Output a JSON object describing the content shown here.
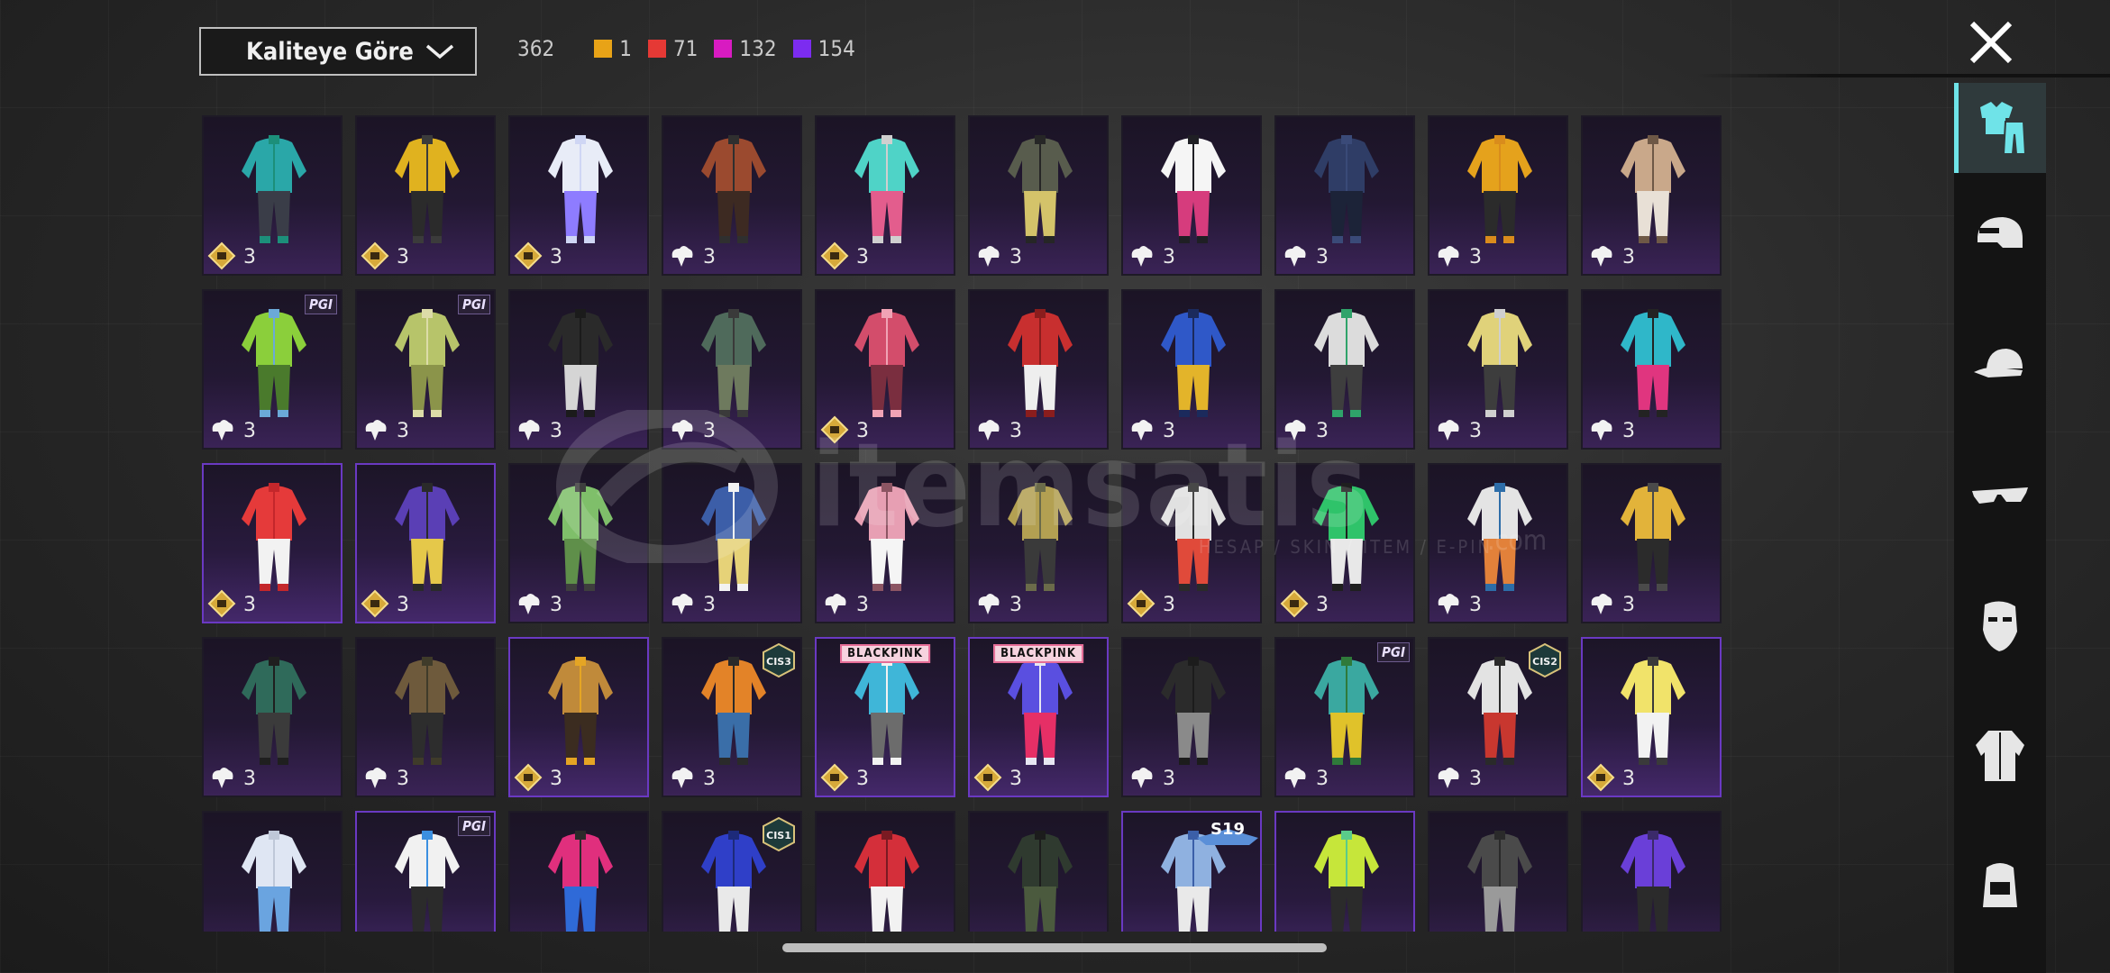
{
  "sort": {
    "label": "Kaliteye Göre"
  },
  "counts": {
    "total": "362",
    "tiers": [
      {
        "color": "#e8a317",
        "value": "1"
      },
      {
        "color": "#e53935",
        "value": "71"
      },
      {
        "color": "#d81bc1",
        "value": "132"
      },
      {
        "color": "#7c2cf0",
        "value": "154"
      }
    ]
  },
  "watermark": {
    "text": "itemsatis",
    "domain": ".com",
    "sub": "HESAP / SKIN / ITEM / E-PIN"
  },
  "grid": {
    "quantity_label": "3",
    "rows": [
      [
        {
          "q": "mythic",
          "hl": false,
          "palette": [
            "#2aa7a8",
            "#3a3d48",
            "#1c8f7a"
          ]
        },
        {
          "q": "mythic",
          "hl": false,
          "palette": [
            "#e0b21f",
            "#2b2b2b",
            "#3b3b3b"
          ]
        },
        {
          "q": "mythic",
          "hl": false,
          "palette": [
            "#e8ecf7",
            "#8e7cff",
            "#cfd6f4"
          ]
        },
        {
          "q": "legendary",
          "hl": false,
          "palette": [
            "#9b4a2f",
            "#3d2a22",
            "#2f2f2f"
          ]
        },
        {
          "q": "mythic",
          "hl": false,
          "palette": [
            "#4fd3c7",
            "#e35d8d",
            "#cfcfcf"
          ]
        },
        {
          "q": "legendary",
          "hl": false,
          "palette": [
            "#585c4d",
            "#d4c36a",
            "#262626"
          ]
        },
        {
          "q": "legendary",
          "hl": false,
          "palette": [
            "#f5f5f5",
            "#d63c7d",
            "#1f1f24"
          ]
        },
        {
          "q": "legendary",
          "hl": false,
          "palette": [
            "#2f3d66",
            "#1c2338",
            "#3a4a78"
          ]
        },
        {
          "q": "legendary",
          "hl": false,
          "palette": [
            "#e5a21c",
            "#2b2b2b",
            "#d98c1c"
          ]
        },
        {
          "q": "legendary",
          "hl": false,
          "palette": [
            "#c9a88a",
            "#e8e0d6",
            "#6e5846"
          ]
        }
      ],
      [
        {
          "q": "legendary",
          "hl": false,
          "palette": [
            "#8bcf3b",
            "#4a7a2c",
            "#6ba9d8"
          ],
          "badge": "pgi"
        },
        {
          "q": "legendary",
          "hl": false,
          "palette": [
            "#b7c46a",
            "#8b944a",
            "#dcdca8"
          ],
          "badge": "pgi"
        },
        {
          "q": "legendary",
          "hl": false,
          "palette": [
            "#2a2a2a",
            "#d5d5d5",
            "#1b1b1b"
          ]
        },
        {
          "q": "legendary",
          "hl": false,
          "palette": [
            "#4f6a5b",
            "#6e7a5e",
            "#3a3a3a"
          ]
        },
        {
          "q": "mythic",
          "hl": false,
          "palette": [
            "#d34d6b",
            "#7a2e3f",
            "#f0a3b5"
          ]
        },
        {
          "q": "legendary",
          "hl": false,
          "palette": [
            "#c82f2f",
            "#eeeeee",
            "#8a1d1d"
          ]
        },
        {
          "q": "legendary",
          "hl": false,
          "palette": [
            "#2f58c8",
            "#e3b42a",
            "#1b2a5c"
          ]
        },
        {
          "q": "legendary",
          "hl": false,
          "palette": [
            "#dcdcdc",
            "#3e3e3e",
            "#2fa36a"
          ]
        },
        {
          "q": "legendary",
          "hl": false,
          "palette": [
            "#e0d27a",
            "#3d3d3d",
            "#cfcfcf"
          ]
        },
        {
          "q": "legendary",
          "hl": false,
          "palette": [
            "#2fb7c9",
            "#e0357f",
            "#232323"
          ]
        }
      ],
      [
        {
          "q": "mythic",
          "hl": true,
          "palette": [
            "#e53a3a",
            "#f2f2f2",
            "#c4272b"
          ]
        },
        {
          "q": "mythic",
          "hl": true,
          "palette": [
            "#5a3fb5",
            "#e5c84a",
            "#2a2a2a"
          ]
        },
        {
          "q": "legendary",
          "hl": false,
          "palette": [
            "#7fbf6a",
            "#5f8f4a",
            "#3e3e3e"
          ]
        },
        {
          "q": "legendary",
          "hl": false,
          "palette": [
            "#3c5ea8",
            "#e6d278",
            "#f2f2f2"
          ]
        },
        {
          "q": "legendary",
          "hl": false,
          "palette": [
            "#e79fb3",
            "#f5f5f5",
            "#8c5563"
          ]
        },
        {
          "q": "legendary",
          "hl": false,
          "palette": [
            "#b3a052",
            "#3a3a3a",
            "#6b6b4a"
          ]
        },
        {
          "q": "mythic",
          "hl": false,
          "palette": [
            "#e1e1e1",
            "#e04a3a",
            "#2a2a2a"
          ]
        },
        {
          "q": "mythic",
          "hl": false,
          "palette": [
            "#2fc36a",
            "#e8e8e8",
            "#1f1f1f"
          ]
        },
        {
          "q": "legendary",
          "hl": false,
          "palette": [
            "#e4e4e4",
            "#e2813a",
            "#2d6da8"
          ]
        },
        {
          "q": "legendary",
          "hl": false,
          "palette": [
            "#e2b33a",
            "#2b2b2b",
            "#4a4a4a"
          ]
        }
      ],
      [
        {
          "q": "legendary",
          "hl": false,
          "palette": [
            "#2f6a5a",
            "#3b3b3b",
            "#1f1f1f"
          ]
        },
        {
          "q": "legendary",
          "hl": false,
          "palette": [
            "#6e5a3c",
            "#2d2d2d",
            "#3f3b2a"
          ]
        },
        {
          "q": "mythic",
          "hl": true,
          "palette": [
            "#c08a3a",
            "#3b2c20",
            "#e5a524"
          ]
        },
        {
          "q": "legendary",
          "hl": false,
          "palette": [
            "#e38328",
            "#3a6ea8",
            "#2a2a2a"
          ],
          "badge": "cis3"
        },
        {
          "q": "mythic",
          "hl": true,
          "palette": [
            "#3fb6d8",
            "#6c6c6c",
            "#f2f2f2"
          ],
          "badge": "blackpink"
        },
        {
          "q": "mythic",
          "hl": true,
          "palette": [
            "#5a4fe0",
            "#e62f66",
            "#e7e7f2"
          ],
          "badge": "blackpink"
        },
        {
          "q": "legendary",
          "hl": false,
          "palette": [
            "#2b2b2b",
            "#8a8a8a",
            "#1c1c1c"
          ]
        },
        {
          "q": "legendary",
          "hl": false,
          "palette": [
            "#3aa8a0",
            "#e0c22a",
            "#2f7a3a"
          ],
          "badge": "pgi"
        },
        {
          "q": "legendary",
          "hl": false,
          "palette": [
            "#e3e3e3",
            "#c8372f",
            "#2a2a2a"
          ],
          "badge": "cis2"
        },
        {
          "q": "mythic",
          "hl": true,
          "palette": [
            "#f1e36a",
            "#f2f2f2",
            "#3a3a3a"
          ]
        }
      ],
      [
        {
          "q": "legendary",
          "hl": false,
          "palette": [
            "#dfe6f3",
            "#6aa4e0",
            "#bfc8d8"
          ]
        },
        {
          "q": "legendary",
          "hl": true,
          "palette": [
            "#f1f1f1",
            "#2b2b2b",
            "#3b8fe0"
          ],
          "badge": "pgi"
        },
        {
          "q": "legendary",
          "hl": false,
          "palette": [
            "#e02f7d",
            "#2f6ad8",
            "#2a2a2a"
          ]
        },
        {
          "q": "legendary",
          "hl": false,
          "palette": [
            "#2f3fc8",
            "#e9e9e9",
            "#1d2a7a"
          ],
          "badge": "cis1"
        },
        {
          "q": "legendary",
          "hl": false,
          "palette": [
            "#d42f3a",
            "#f2f2f2",
            "#7a1a22"
          ]
        },
        {
          "q": "legendary",
          "hl": false,
          "palette": [
            "#2f3a2f",
            "#4b5a3e",
            "#1c1c1c"
          ]
        },
        {
          "q": "legendary",
          "hl": true,
          "palette": [
            "#8fb1e0",
            "#e9e9e9",
            "#3b5fa8"
          ],
          "badge": "s19"
        },
        {
          "q": "legendary",
          "hl": true,
          "palette": [
            "#c6e63a",
            "#2b2b2b",
            "#5acb8a"
          ]
        },
        {
          "q": "legendary",
          "hl": false,
          "palette": [
            "#4a4a4a",
            "#9a9a9a",
            "#2a2a2a"
          ]
        },
        {
          "q": "legendary",
          "hl": false,
          "palette": [
            "#6a3fd8",
            "#2b2b2b",
            "#3b2a6a"
          ]
        }
      ]
    ]
  },
  "badges": {
    "pgi": "PGI",
    "cis1": "CIS1",
    "cis2": "CIS2",
    "cis3": "CIS3",
    "blackpink": "BLACKPINK",
    "s19": "S19"
  },
  "sidebar": {
    "items": [
      {
        "icon": "outfit-icon",
        "active": true
      },
      {
        "icon": "helmet-icon",
        "active": false
      },
      {
        "icon": "cap-icon",
        "active": false
      },
      {
        "icon": "sunglasses-icon",
        "active": false
      },
      {
        "icon": "face-mask-icon",
        "active": false
      },
      {
        "icon": "jacket-icon",
        "active": false
      },
      {
        "icon": "backpack-icon",
        "active": false
      }
    ]
  }
}
